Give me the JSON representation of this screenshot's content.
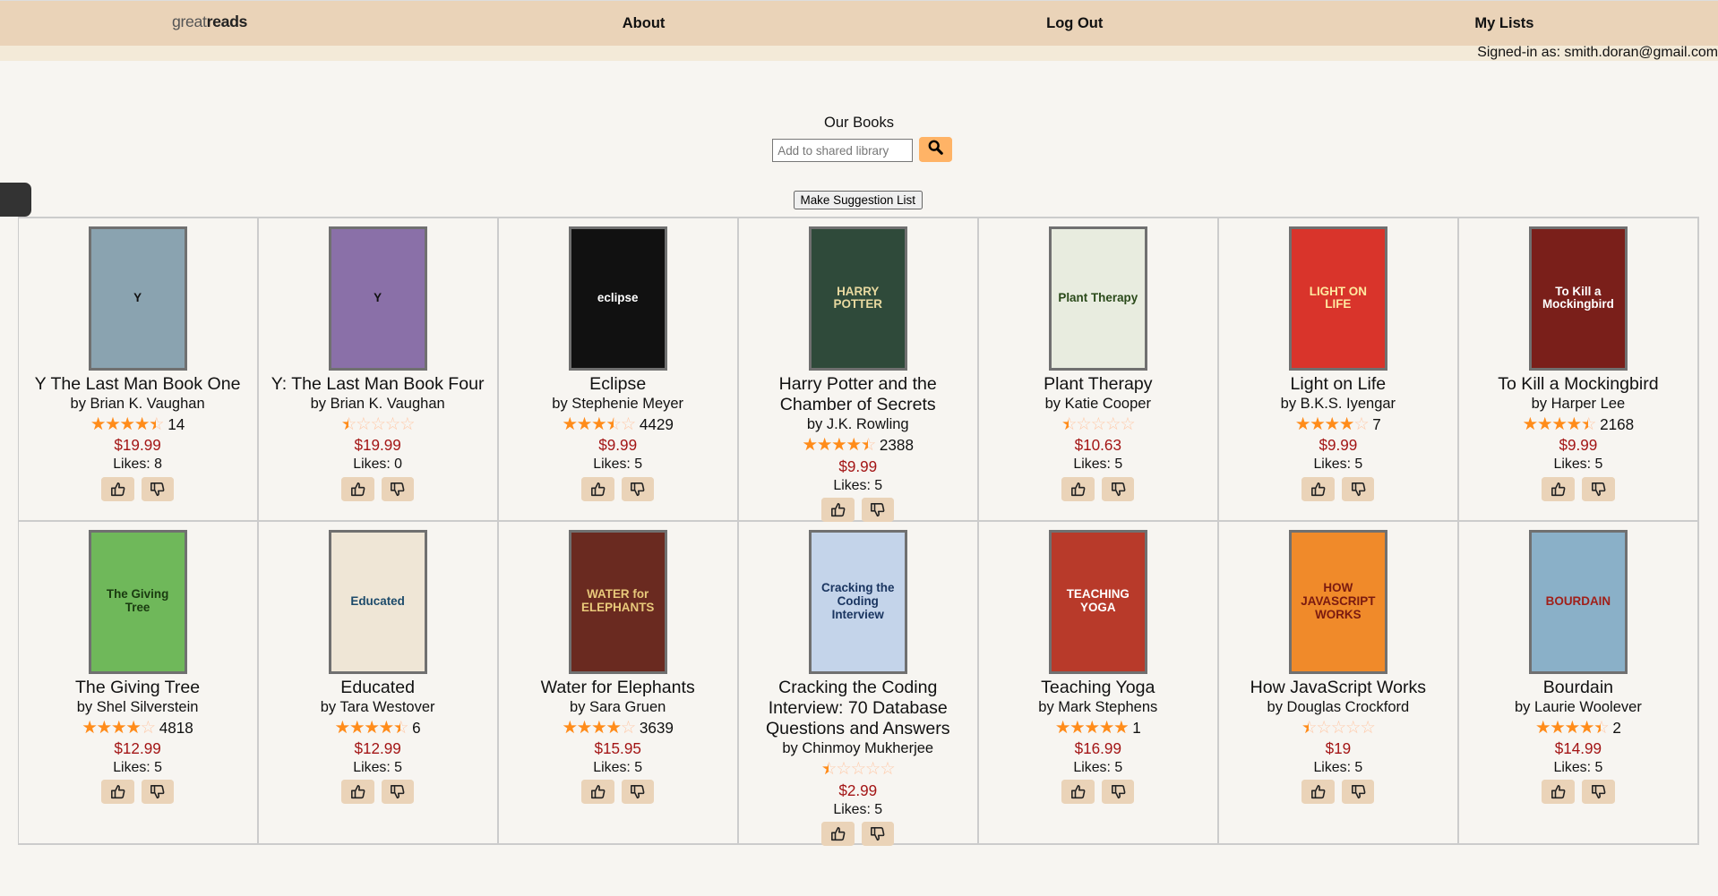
{
  "nav": {
    "logo_light": "great",
    "logo_bold": "reads",
    "about": "About",
    "logout": "Log Out",
    "my_lists": "My Lists",
    "signed_in": "Signed-in as: smith.doran@gmail.com"
  },
  "main": {
    "heading": "Our Books",
    "search_placeholder": "Add to shared library",
    "suggest_label": "Make Suggestion List"
  },
  "colors": {
    "nav_bg": "#ead3b8",
    "accent": "#ffb366",
    "price": "#a31515",
    "star": "#ff8c1a"
  },
  "books": [
    {
      "title": "Y The Last Man Book One",
      "author": "by Brian K. Vaughan",
      "rating": 4.5,
      "count": "14",
      "price": "$19.99",
      "likes": "Likes: 8",
      "cover_bg": "#8aa3b0",
      "cover_fg": "#111",
      "cover_text": "Y"
    },
    {
      "title": "Y: The Last Man Book Four",
      "author": "by Brian K. Vaughan",
      "rating": 0.5,
      "count": "",
      "price": "$19.99",
      "likes": "Likes: 0",
      "cover_bg": "#8a70a8",
      "cover_fg": "#111",
      "cover_text": "Y"
    },
    {
      "title": "Eclipse",
      "author": "by Stephenie Meyer",
      "rating": 3.5,
      "count": "4429",
      "price": "$9.99",
      "likes": "Likes: 5",
      "cover_bg": "#111",
      "cover_fg": "#fff",
      "cover_text": "eclipse"
    },
    {
      "title": "Harry Potter and the Chamber of Secrets",
      "author": "by J.K. Rowling",
      "rating": 4.5,
      "count": "2388",
      "price": "$9.99",
      "likes": "Likes: 5",
      "cover_bg": "#2f4a3a",
      "cover_fg": "#e8d9a0",
      "cover_text": "HARRY POTTER"
    },
    {
      "title": "Plant Therapy",
      "author": "by Katie Cooper",
      "rating": 0.5,
      "count": "",
      "price": "$10.63",
      "likes": "Likes: 5",
      "cover_bg": "#e8ecdf",
      "cover_fg": "#2a4a1a",
      "cover_text": "Plant Therapy"
    },
    {
      "title": "Light on Life",
      "author": "by B.K.S. Iyengar",
      "rating": 4,
      "count": "7",
      "price": "$9.99",
      "likes": "Likes: 5",
      "cover_bg": "#d9342b",
      "cover_fg": "#ffe9a0",
      "cover_text": "LIGHT ON LIFE"
    },
    {
      "title": "To Kill a Mockingbird",
      "author": "by Harper Lee",
      "rating": 4.5,
      "count": "2168",
      "price": "$9.99",
      "likes": "Likes: 5",
      "cover_bg": "#7a1f1a",
      "cover_fg": "#fff",
      "cover_text": "To Kill a Mockingbird"
    },
    {
      "title": "The Giving Tree",
      "author": "by Shel Silverstein",
      "rating": 4,
      "count": "4818",
      "price": "$12.99",
      "likes": "Likes: 5",
      "cover_bg": "#6fb85a",
      "cover_fg": "#1a3a10",
      "cover_text": "The Giving Tree"
    },
    {
      "title": "Educated",
      "author": "by Tara Westover",
      "rating": 4.5,
      "count": "6",
      "price": "$12.99",
      "likes": "Likes: 5",
      "cover_bg": "#efe6d6",
      "cover_fg": "#1c4a6a",
      "cover_text": "Educated"
    },
    {
      "title": "Water for Elephants",
      "author": "by Sara Gruen",
      "rating": 4,
      "count": "3639",
      "price": "$15.95",
      "likes": "Likes: 5",
      "cover_bg": "#6a2a20",
      "cover_fg": "#e8c97a",
      "cover_text": "WATER for ELEPHANTS"
    },
    {
      "title": "Cracking the Coding Interview: 70 Database Questions and Answers",
      "author": "by Chinmoy Mukherjee",
      "rating": 0.5,
      "count": "",
      "price": "$2.99",
      "likes": "Likes: 5",
      "cover_bg": "#c4d4ea",
      "cover_fg": "#1a3560",
      "cover_text": "Cracking the Coding Interview"
    },
    {
      "title": "Teaching Yoga",
      "author": "by Mark Stephens",
      "rating": 5,
      "count": "1",
      "price": "$16.99",
      "likes": "Likes: 5",
      "cover_bg": "#b83a2a",
      "cover_fg": "#fff",
      "cover_text": "TEACHING YOGA"
    },
    {
      "title": "How JavaScript Works",
      "author": "by Douglas Crockford",
      "rating": 0.5,
      "count": "",
      "price": "$19",
      "likes": "Likes: 5",
      "cover_bg": "#f08a2a",
      "cover_fg": "#7a1a10",
      "cover_text": "HOW JAVASCRIPT WORKS"
    },
    {
      "title": "Bourdain",
      "author": "by Laurie Woolever",
      "rating": 4.5,
      "count": "2",
      "price": "$14.99",
      "likes": "Likes: 5",
      "cover_bg": "#8ab0c8",
      "cover_fg": "#a0201a",
      "cover_text": "BOURDAIN"
    }
  ]
}
